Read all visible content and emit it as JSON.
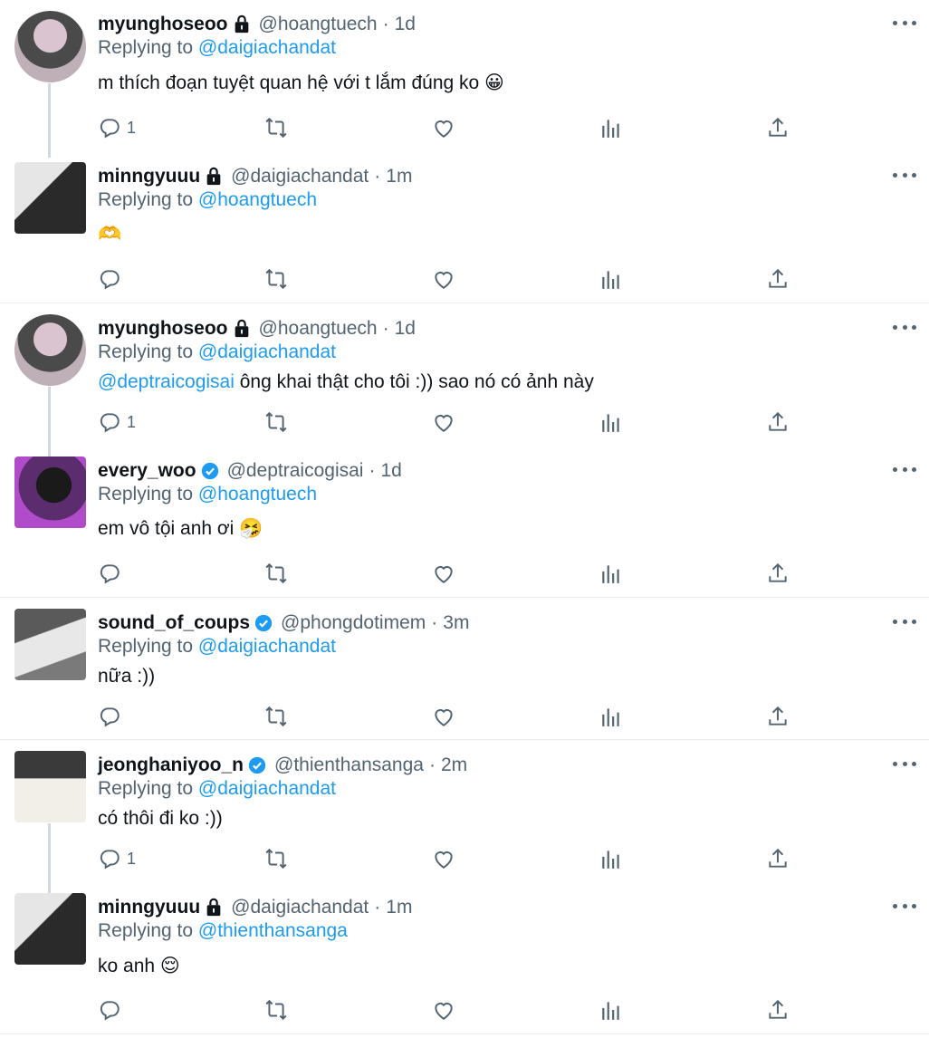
{
  "tweets": [
    {
      "name": "myunghoseoo",
      "badge": "lock",
      "handle": "@hoangtuech",
      "time": "1d",
      "replying_label": "Replying to",
      "replying_to": "@daigiachandat",
      "text_mention": "",
      "text": "m thích đoạn tuyệt quan hệ với t lắm đúng ko 😀",
      "reply_count": "1",
      "avatar_palette": [
        "#3a3a3a",
        "#c9b7c2"
      ]
    },
    {
      "name": "minngyuuu",
      "badge": "lock",
      "handle": "@daigiachandat",
      "time": "1m",
      "replying_label": "Replying to",
      "replying_to": "@hoangtuech",
      "text_mention": "",
      "text": "🫶",
      "reply_count": "",
      "avatar_palette": [
        "#1c1c1c",
        "#dcdcdc"
      ]
    },
    {
      "name": "myunghoseoo",
      "badge": "lock",
      "handle": "@hoangtuech",
      "time": "1d",
      "replying_label": "Replying to",
      "replying_to": "@daigiachandat",
      "text_mention": "@deptraicogisai",
      "text": " ông khai thật cho tôi :)) sao nó có ảnh này",
      "reply_count": "1",
      "avatar_palette": [
        "#3a3a3a",
        "#c9b7c2"
      ]
    },
    {
      "name": "every_woo",
      "badge": "verified",
      "handle": "@deptraicogisai",
      "time": "1d",
      "replying_label": "Replying to",
      "replying_to": "@hoangtuech",
      "text_mention": "",
      "text": "em vô tội anh ơi 🤧",
      "reply_count": "",
      "avatar_palette": [
        "#3a1d4a",
        "#b04cc9"
      ]
    },
    {
      "name": "sound_of_coups",
      "badge": "verified",
      "handle": "@phongdotimem",
      "time": "3m",
      "replying_label": "Replying to",
      "replying_to": "@daigiachandat",
      "text_mention": "",
      "text": "nữa :))",
      "reply_count": "",
      "avatar_palette": [
        "#6e6e6e",
        "#e8e8e8"
      ]
    },
    {
      "name": "jeonghaniyoo_n",
      "badge": "verified",
      "handle": "@thienthansanga",
      "time": "2m",
      "replying_label": "Replying to",
      "replying_to": "@daigiachandat",
      "text_mention": "",
      "text": "có thôi đi ko :))",
      "reply_count": "1",
      "avatar_palette": [
        "#2b2b2b",
        "#f2efe9"
      ]
    },
    {
      "name": "minngyuuu",
      "badge": "lock",
      "handle": "@daigiachandat",
      "time": "1m",
      "replying_label": "Replying to",
      "replying_to": "@thienthansanga",
      "text_mention": "",
      "text": "ko anh 😌",
      "reply_count": "",
      "avatar_palette": [
        "#1c1c1c",
        "#dcdcdc"
      ]
    }
  ],
  "icons": {
    "reply": "reply-icon",
    "retweet": "retweet-icon",
    "like": "heart-icon",
    "views": "analytics-icon",
    "share": "share-icon",
    "more": "more-icon"
  },
  "colors": {
    "link": "#1d9bf0",
    "muted": "#536471",
    "divider": "#e6ecf0",
    "verified": "#1d9bf0"
  }
}
